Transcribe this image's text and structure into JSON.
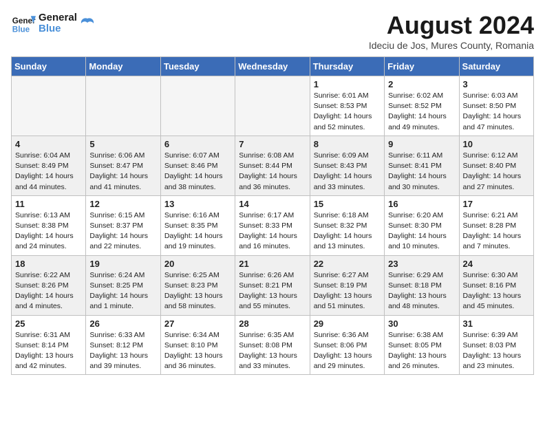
{
  "header": {
    "logo_line1": "General",
    "logo_line2": "Blue",
    "month": "August 2024",
    "location": "Ideciu de Jos, Mures County, Romania"
  },
  "days_of_week": [
    "Sunday",
    "Monday",
    "Tuesday",
    "Wednesday",
    "Thursday",
    "Friday",
    "Saturday"
  ],
  "weeks": [
    [
      {
        "num": "",
        "empty": true
      },
      {
        "num": "",
        "empty": true
      },
      {
        "num": "",
        "empty": true
      },
      {
        "num": "",
        "empty": true
      },
      {
        "num": "1",
        "sunrise": "6:01 AM",
        "sunset": "8:53 PM",
        "daylight": "14 hours and 52 minutes."
      },
      {
        "num": "2",
        "sunrise": "6:02 AM",
        "sunset": "8:52 PM",
        "daylight": "14 hours and 49 minutes."
      },
      {
        "num": "3",
        "sunrise": "6:03 AM",
        "sunset": "8:50 PM",
        "daylight": "14 hours and 47 minutes."
      }
    ],
    [
      {
        "num": "4",
        "sunrise": "6:04 AM",
        "sunset": "8:49 PM",
        "daylight": "14 hours and 44 minutes."
      },
      {
        "num": "5",
        "sunrise": "6:06 AM",
        "sunset": "8:47 PM",
        "daylight": "14 hours and 41 minutes."
      },
      {
        "num": "6",
        "sunrise": "6:07 AM",
        "sunset": "8:46 PM",
        "daylight": "14 hours and 38 minutes."
      },
      {
        "num": "7",
        "sunrise": "6:08 AM",
        "sunset": "8:44 PM",
        "daylight": "14 hours and 36 minutes."
      },
      {
        "num": "8",
        "sunrise": "6:09 AM",
        "sunset": "8:43 PM",
        "daylight": "14 hours and 33 minutes."
      },
      {
        "num": "9",
        "sunrise": "6:11 AM",
        "sunset": "8:41 PM",
        "daylight": "14 hours and 30 minutes."
      },
      {
        "num": "10",
        "sunrise": "6:12 AM",
        "sunset": "8:40 PM",
        "daylight": "14 hours and 27 minutes."
      }
    ],
    [
      {
        "num": "11",
        "sunrise": "6:13 AM",
        "sunset": "8:38 PM",
        "daylight": "14 hours and 24 minutes."
      },
      {
        "num": "12",
        "sunrise": "6:15 AM",
        "sunset": "8:37 PM",
        "daylight": "14 hours and 22 minutes."
      },
      {
        "num": "13",
        "sunrise": "6:16 AM",
        "sunset": "8:35 PM",
        "daylight": "14 hours and 19 minutes."
      },
      {
        "num": "14",
        "sunrise": "6:17 AM",
        "sunset": "8:33 PM",
        "daylight": "14 hours and 16 minutes."
      },
      {
        "num": "15",
        "sunrise": "6:18 AM",
        "sunset": "8:32 PM",
        "daylight": "14 hours and 13 minutes."
      },
      {
        "num": "16",
        "sunrise": "6:20 AM",
        "sunset": "8:30 PM",
        "daylight": "14 hours and 10 minutes."
      },
      {
        "num": "17",
        "sunrise": "6:21 AM",
        "sunset": "8:28 PM",
        "daylight": "14 hours and 7 minutes."
      }
    ],
    [
      {
        "num": "18",
        "sunrise": "6:22 AM",
        "sunset": "8:26 PM",
        "daylight": "14 hours and 4 minutes."
      },
      {
        "num": "19",
        "sunrise": "6:24 AM",
        "sunset": "8:25 PM",
        "daylight": "14 hours and 1 minute."
      },
      {
        "num": "20",
        "sunrise": "6:25 AM",
        "sunset": "8:23 PM",
        "daylight": "13 hours and 58 minutes."
      },
      {
        "num": "21",
        "sunrise": "6:26 AM",
        "sunset": "8:21 PM",
        "daylight": "13 hours and 55 minutes."
      },
      {
        "num": "22",
        "sunrise": "6:27 AM",
        "sunset": "8:19 PM",
        "daylight": "13 hours and 51 minutes."
      },
      {
        "num": "23",
        "sunrise": "6:29 AM",
        "sunset": "8:18 PM",
        "daylight": "13 hours and 48 minutes."
      },
      {
        "num": "24",
        "sunrise": "6:30 AM",
        "sunset": "8:16 PM",
        "daylight": "13 hours and 45 minutes."
      }
    ],
    [
      {
        "num": "25",
        "sunrise": "6:31 AM",
        "sunset": "8:14 PM",
        "daylight": "13 hours and 42 minutes."
      },
      {
        "num": "26",
        "sunrise": "6:33 AM",
        "sunset": "8:12 PM",
        "daylight": "13 hours and 39 minutes."
      },
      {
        "num": "27",
        "sunrise": "6:34 AM",
        "sunset": "8:10 PM",
        "daylight": "13 hours and 36 minutes."
      },
      {
        "num": "28",
        "sunrise": "6:35 AM",
        "sunset": "8:08 PM",
        "daylight": "13 hours and 33 minutes."
      },
      {
        "num": "29",
        "sunrise": "6:36 AM",
        "sunset": "8:06 PM",
        "daylight": "13 hours and 29 minutes."
      },
      {
        "num": "30",
        "sunrise": "6:38 AM",
        "sunset": "8:05 PM",
        "daylight": "13 hours and 26 minutes."
      },
      {
        "num": "31",
        "sunrise": "6:39 AM",
        "sunset": "8:03 PM",
        "daylight": "13 hours and 23 minutes."
      }
    ]
  ]
}
